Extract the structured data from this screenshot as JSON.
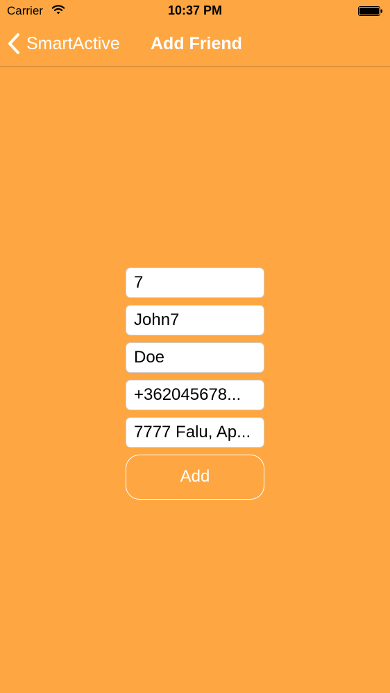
{
  "status_bar": {
    "carrier": "Carrier",
    "time": "10:37 PM",
    "wifi_icon": "wifi-icon",
    "battery_icon": "battery-icon"
  },
  "nav": {
    "back_label": "SmartActive",
    "back_icon": "chevron-left-icon",
    "title": "Add Friend"
  },
  "form": {
    "fields": [
      {
        "value": "7"
      },
      {
        "value": "John7"
      },
      {
        "value": "Doe"
      },
      {
        "value": "+362045678..."
      },
      {
        "value": "7777 Falu, Ap..."
      }
    ],
    "add_label": "Add"
  },
  "colors": {
    "background": "#FEA742",
    "text": "#FFFFFF",
    "field_background": "#FFFFFF"
  }
}
